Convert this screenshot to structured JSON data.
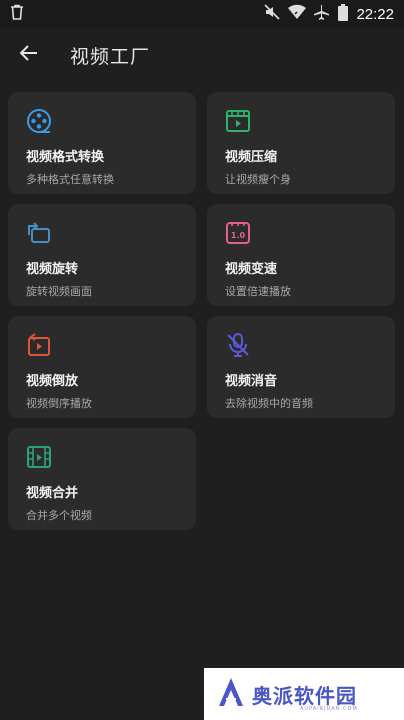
{
  "status_bar": {
    "time": "22:22",
    "icons": [
      "trash-icon",
      "mute-icon",
      "wifi-icon",
      "airplane-icon",
      "battery-icon"
    ]
  },
  "header": {
    "title": "视频工厂",
    "back_icon": "arrow-left-icon"
  },
  "tools": [
    {
      "name": "视频格式转换",
      "desc": "多种格式任意转换",
      "icon": "film-reel-icon",
      "color": "#3a9be8"
    },
    {
      "name": "视频压缩",
      "desc": "让视频瘦个身",
      "icon": "compress-icon",
      "color": "#2fb36a"
    },
    {
      "name": "视频旋转",
      "desc": "旋转视频画面",
      "icon": "rotate-icon",
      "color": "#4a8fc4"
    },
    {
      "name": "视频变速",
      "desc": "设置倍速播放",
      "icon": "speed-icon",
      "color": "#e8608a"
    },
    {
      "name": "视频倒放",
      "desc": "视频倒序播放",
      "icon": "reverse-icon",
      "color": "#e0553a"
    },
    {
      "name": "视频消音",
      "desc": "去除视频中的音频",
      "icon": "mic-off-icon",
      "color": "#5a5ad8"
    },
    {
      "name": "视频合并",
      "desc": "合并多个视频",
      "icon": "merge-film-icon",
      "color": "#2fa07a"
    }
  ],
  "watermark": {
    "text": "奥派软件园",
    "sub": "AUPAIRJUAN.COM"
  }
}
